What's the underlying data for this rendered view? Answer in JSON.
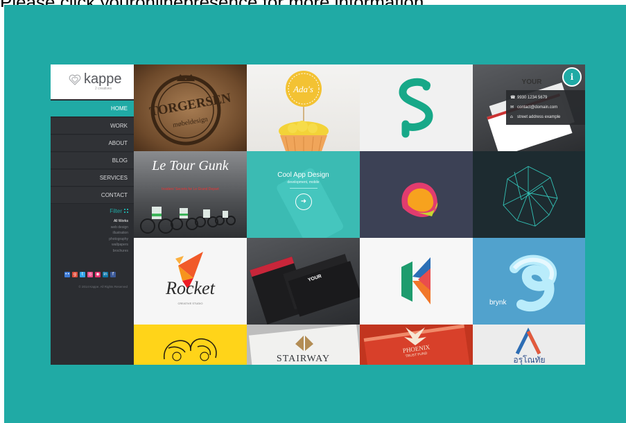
{
  "banner": "Please click youronlinepresence for more information.",
  "logo": {
    "name": "kappe",
    "tagline": "2 creatives"
  },
  "nav": [
    {
      "label": "HOME",
      "active": true
    },
    {
      "label": "WORK",
      "active": false
    },
    {
      "label": "ABOUT",
      "active": false
    },
    {
      "label": "BLOG",
      "active": false
    },
    {
      "label": "SERVICES",
      "active": false
    },
    {
      "label": "CONTACT",
      "active": false
    }
  ],
  "filter": {
    "title": "Filter",
    "items": [
      "All Works",
      "web design",
      "illustration",
      "photography",
      "wallpapers",
      "brochures"
    ]
  },
  "social_icons": [
    "flickr-icon",
    "google-plus-icon",
    "twitter-icon",
    "dribbble-icon",
    "instagram-icon",
    "linkedin-icon",
    "facebook-icon"
  ],
  "copyright": "© 2014 Kappe. All Rights Reserved",
  "contact": {
    "phone": "9930 1234 5679",
    "email": "contact@domain.com",
    "address": "street address example"
  },
  "tiles": {
    "torgersen_line1": "TORGERSEN",
    "torgersen_line2": "møbeldesign",
    "adas": "Ada's",
    "your": "YOUR",
    "tour_title": "Le Tour Gunk",
    "tour_sub": "Insiders' Secrets for Le Grand Depart",
    "featured_title": "Cool App Design",
    "featured_sub": "development, mobile",
    "rocket": "Rocket",
    "rocket_sub": "CREATIVE STUDIO",
    "brynk": "brynk",
    "stairway": "STAIRWAY",
    "phoenix_line1": "PHOENIX",
    "phoenix_line2": "TRUST FUND",
    "thai": "อรุโณทัย"
  },
  "colors": {
    "accent": "#20aaa5",
    "sidebar": "#2b2d31"
  }
}
